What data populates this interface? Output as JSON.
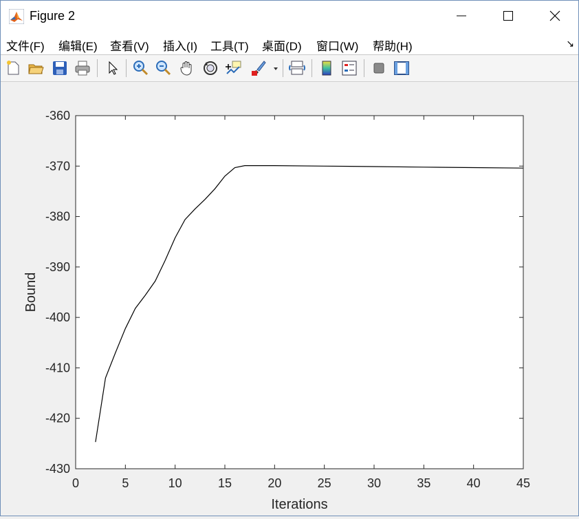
{
  "window": {
    "title": "Figure 2"
  },
  "menu": {
    "items": [
      "文件(F)",
      "编辑(E)",
      "查看(V)",
      "插入(I)",
      "工具(T)",
      "桌面(D)",
      "窗口(W)",
      "帮助(H)"
    ]
  },
  "toolbar": {
    "buttons": [
      "new-figure-icon",
      "open-file-icon",
      "save-icon",
      "print-icon",
      "pointer-icon",
      "zoom-in-icon",
      "zoom-out-icon",
      "pan-hand-icon",
      "rotate-3d-icon",
      "data-cursor-icon",
      "brush-icon",
      "link-plot-icon",
      "colorbar-icon",
      "legend-icon",
      "hide-plot-tools-icon",
      "show-plot-tools-icon"
    ]
  },
  "chart_data": {
    "type": "line",
    "title": "",
    "xlabel": "Iterations",
    "ylabel": "Bound",
    "xlim": [
      0,
      45
    ],
    "ylim": [
      -430,
      -360
    ],
    "xticks": [
      0,
      5,
      10,
      15,
      20,
      25,
      30,
      35,
      40,
      45
    ],
    "yticks": [
      -360,
      -370,
      -380,
      -390,
      -400,
      -410,
      -420,
      -430
    ],
    "grid": false,
    "series": [
      {
        "color": "#000000",
        "x": [
          2,
          3,
          4,
          5,
          6,
          7,
          8,
          9,
          10,
          11,
          12,
          13,
          14,
          15,
          16,
          17,
          20,
          25,
          30,
          35,
          40,
          45
        ],
        "y": [
          -424.7,
          -412.0,
          -407.0,
          -402.2,
          -398.2,
          -395.6,
          -392.8,
          -388.7,
          -384.2,
          -380.6,
          -378.5,
          -376.6,
          -374.5,
          -372.0,
          -370.3,
          -369.9,
          -369.9,
          -370.0,
          -370.1,
          -370.2,
          -370.3,
          -370.4
        ]
      }
    ]
  }
}
